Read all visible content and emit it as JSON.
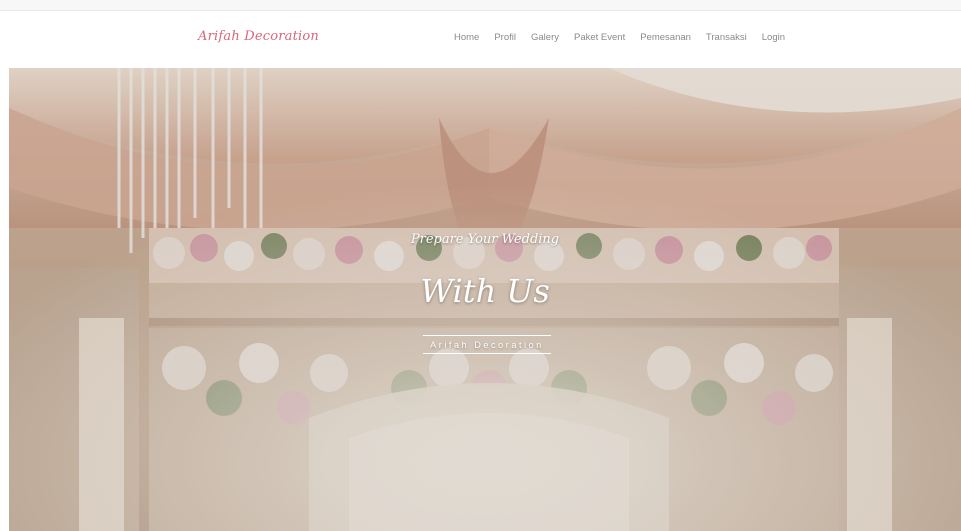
{
  "navbar": {
    "brand": "Arifah Decoration",
    "links": [
      {
        "label": "Home"
      },
      {
        "label": "Profil"
      },
      {
        "label": "Galery"
      },
      {
        "label": "Paket Event"
      },
      {
        "label": "Pemesanan"
      },
      {
        "label": "Transaksi"
      },
      {
        "label": "Login"
      }
    ]
  },
  "hero": {
    "subtitle": "Prepare Your Wedding",
    "title": "With Us",
    "tagline": "Arifah Decoration"
  },
  "colors": {
    "brand": "#d9667a",
    "nav_text": "#8a8a8a",
    "hero_overlay": "#c7a793",
    "hero_text": "#ffffff"
  }
}
